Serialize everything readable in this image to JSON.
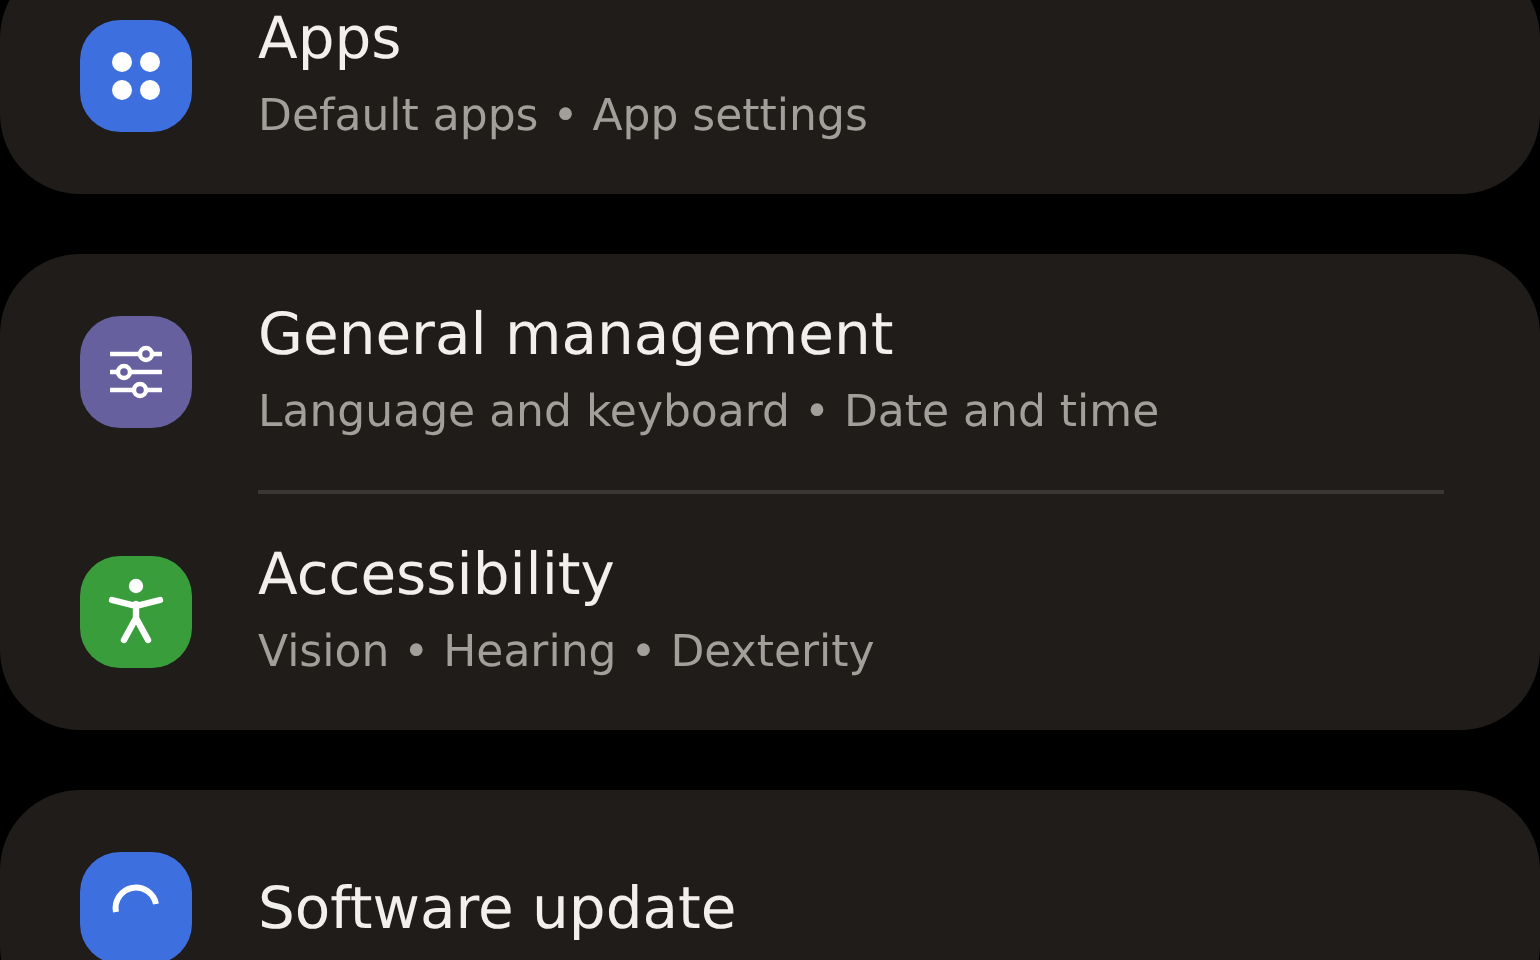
{
  "sections": [
    {
      "items": [
        {
          "kind": "apps",
          "color": "#3e6fdf",
          "title": "Apps",
          "subtitle": "Default apps • App settings"
        }
      ]
    },
    {
      "items": [
        {
          "kind": "sliders",
          "color": "#67609f",
          "title": "General management",
          "subtitle": "Language and keyboard • Date and time"
        },
        {
          "kind": "accessibility",
          "color": "#3a9d3c",
          "title": "Accessibility",
          "subtitle": "Vision • Hearing • Dexterity"
        }
      ]
    },
    {
      "items": [
        {
          "kind": "update",
          "color": "#3e6fdf",
          "title": "Software update"
        }
      ]
    }
  ]
}
